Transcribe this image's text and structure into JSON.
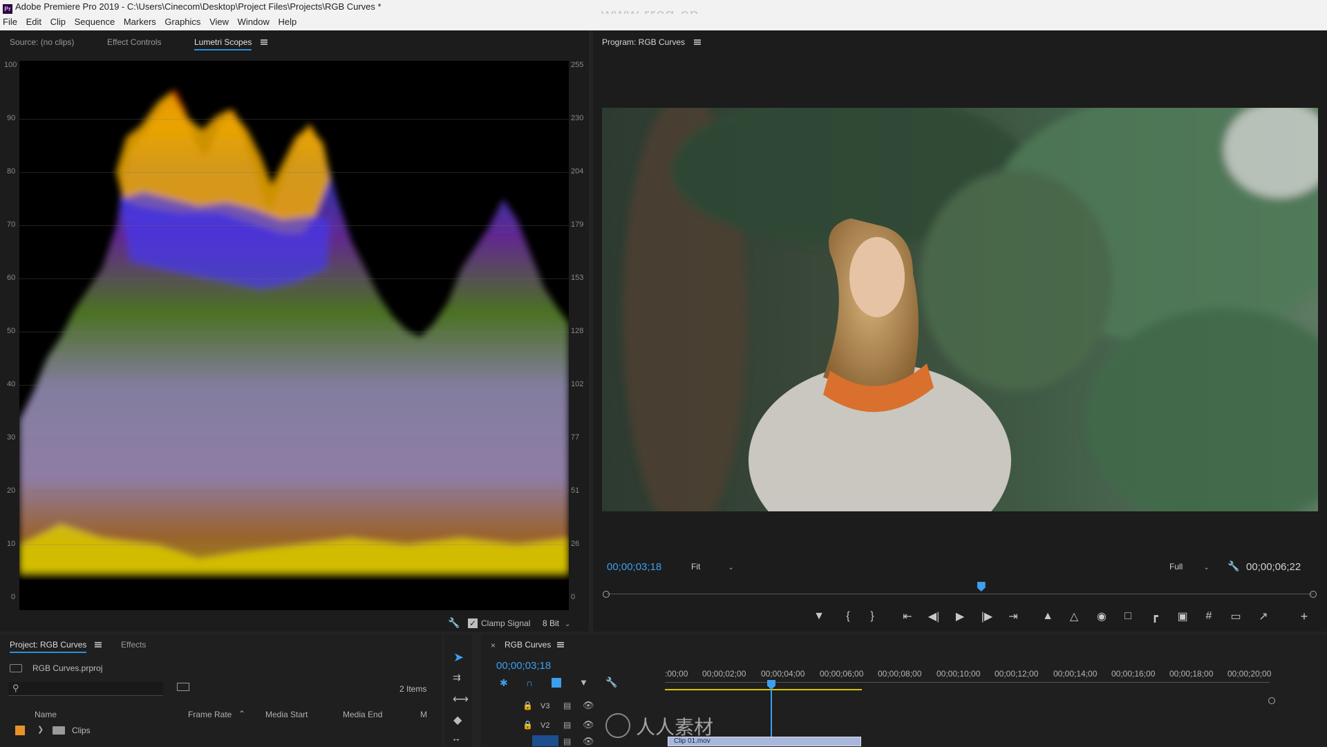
{
  "app": {
    "title": "Adobe Premiere Pro 2019 - C:\\Users\\Cinecom\\Desktop\\Project Files\\Projects\\RGB Curves *",
    "logo_text": "Pr",
    "watermark": "www.rrcg.cn"
  },
  "menu": [
    "File",
    "Edit",
    "Clip",
    "Sequence",
    "Markers",
    "Graphics",
    "View",
    "Window",
    "Help"
  ],
  "source_panel": {
    "tabs": [
      "Source: (no clips)",
      "Effect Controls",
      "Lumetri Scopes"
    ],
    "active_tab": "Lumetri Scopes",
    "scale_left": [
      "100",
      "90",
      "80",
      "70",
      "60",
      "50",
      "40",
      "30",
      "20",
      "10",
      "0"
    ],
    "scale_right": [
      "255",
      "230",
      "204",
      "179",
      "153",
      "128",
      "102",
      "77",
      "51",
      "26",
      "0"
    ],
    "clamp_signal_label": "Clamp Signal",
    "clamp_signal_checked": true,
    "bit_depth": "8 Bit"
  },
  "program_panel": {
    "title": "Program: RGB Curves",
    "current_timecode": "00;00;03;18",
    "fit_label": "Fit",
    "quality_label": "Full",
    "duration_timecode": "00;00;06;22",
    "playhead_fraction": 0.53
  },
  "project_panel": {
    "tabs": [
      "Project: RGB Curves",
      "Effects"
    ],
    "project_file": "RGB Curves.prproj",
    "item_count": "2 Items",
    "columns": [
      "Name",
      "Frame Rate",
      "Media Start",
      "Media End",
      "M"
    ],
    "rows": [
      {
        "name": "Clips",
        "label_color": "#e8932a"
      }
    ]
  },
  "timeline_panel": {
    "sequence_name": "RGB Curves",
    "timecode": "00;00;03;18",
    "ruler": [
      ":00;00",
      "00;00;02;00",
      "00;00;04;00",
      "00;00;06;00",
      "00;00;08;00",
      "00;00;10;00",
      "00;00;12;00",
      "00;00;14;00",
      "00;00;16;00",
      "00;00;18;00",
      "00;00;20;00"
    ],
    "tracks": [
      "V3",
      "V2"
    ],
    "clip_name": "Clip 01.mov",
    "overlay_watermark": "人人素材"
  },
  "colors": {
    "accent_blue": "#3d9ff0",
    "panel_bg": "#1c1c1c",
    "label_orange": "#e8932a"
  }
}
